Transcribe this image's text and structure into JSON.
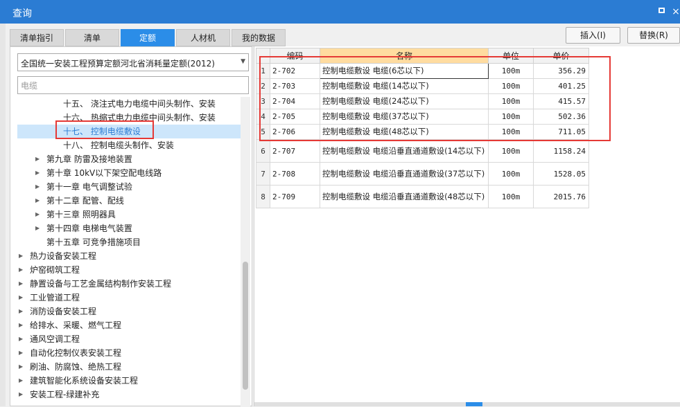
{
  "window": {
    "title": "查询",
    "maximize_icon": "maximize-icon",
    "close_icon": "close-icon",
    "close_glyph": "×"
  },
  "tabs": [
    {
      "label": "清单指引",
      "active": false
    },
    {
      "label": "清单",
      "active": false
    },
    {
      "label": "定额",
      "active": true
    },
    {
      "label": "人材机",
      "active": false
    },
    {
      "label": "我的数据",
      "active": false
    }
  ],
  "actions": {
    "insert_label": "插入(I)",
    "replace_label": "替换(R)"
  },
  "left": {
    "quota_selected": "全国统一安装工程预算定额河北省消耗量定额(2012)",
    "search_value": "电缆",
    "tree": [
      {
        "label": "十五、 浇注式电力电缆中间头制作、安装",
        "indent": 3,
        "expander": false,
        "selected": false
      },
      {
        "label": "十六、 热缩式电力电缆中间头制作、安装",
        "indent": 3,
        "expander": false,
        "selected": false
      },
      {
        "label": "十七、 控制电缆敷设",
        "indent": 3,
        "expander": false,
        "selected": true
      },
      {
        "label": "十八、 控制电缆头制作、安装",
        "indent": 3,
        "expander": false,
        "selected": false
      },
      {
        "label": "第九章 防雷及接地装置",
        "indent": 2,
        "expander": true,
        "selected": false
      },
      {
        "label": "第十章 10kV以下架空配电线路",
        "indent": 2,
        "expander": true,
        "selected": false
      },
      {
        "label": "第十一章 电气调整试验",
        "indent": 2,
        "expander": true,
        "selected": false
      },
      {
        "label": "第十二章 配管、配线",
        "indent": 2,
        "expander": true,
        "selected": false
      },
      {
        "label": "第十三章 照明器具",
        "indent": 2,
        "expander": true,
        "selected": false
      },
      {
        "label": "第十四章 电梯电气装置",
        "indent": 2,
        "expander": true,
        "selected": false
      },
      {
        "label": "第十五章 可竞争措施项目",
        "indent": 2,
        "expander": false,
        "selected": false
      },
      {
        "label": "热力设备安装工程",
        "indent": 1,
        "expander": true,
        "selected": false
      },
      {
        "label": "炉窑砌筑工程",
        "indent": 1,
        "expander": true,
        "selected": false
      },
      {
        "label": "静置设备与工艺金属结构制作安装工程",
        "indent": 1,
        "expander": true,
        "selected": false
      },
      {
        "label": "工业管道工程",
        "indent": 1,
        "expander": true,
        "selected": false
      },
      {
        "label": "消防设备安装工程",
        "indent": 1,
        "expander": true,
        "selected": false
      },
      {
        "label": "给排水、采暖、燃气工程",
        "indent": 1,
        "expander": true,
        "selected": false
      },
      {
        "label": "通风空调工程",
        "indent": 1,
        "expander": true,
        "selected": false
      },
      {
        "label": "自动化控制仪表安装工程",
        "indent": 1,
        "expander": true,
        "selected": false
      },
      {
        "label": "刷油、防腐蚀、绝热工程",
        "indent": 1,
        "expander": true,
        "selected": false
      },
      {
        "label": "建筑智能化系统设备安装工程",
        "indent": 1,
        "expander": true,
        "selected": false
      },
      {
        "label": "安装工程-绿建补充",
        "indent": 1,
        "expander": true,
        "selected": false
      }
    ]
  },
  "grid": {
    "headers": {
      "code": "编码",
      "name": "名称",
      "unit": "单位",
      "price": "单价"
    },
    "rows": [
      {
        "idx": "1",
        "code": "2-702",
        "name": "控制电缆敷设 电缆(6芯以下)",
        "unit": "100m",
        "price": "356.29",
        "tall": false
      },
      {
        "idx": "2",
        "code": "2-703",
        "name": "控制电缆敷设 电缆(14芯以下)",
        "unit": "100m",
        "price": "401.25",
        "tall": false
      },
      {
        "idx": "3",
        "code": "2-704",
        "name": "控制电缆敷设 电缆(24芯以下)",
        "unit": "100m",
        "price": "415.57",
        "tall": false
      },
      {
        "idx": "4",
        "code": "2-705",
        "name": "控制电缆敷设 电缆(37芯以下)",
        "unit": "100m",
        "price": "502.36",
        "tall": false
      },
      {
        "idx": "5",
        "code": "2-706",
        "name": "控制电缆敷设 电缆(48芯以下)",
        "unit": "100m",
        "price": "711.05",
        "tall": false
      },
      {
        "idx": "6",
        "code": "2-707",
        "name": "控制电缆敷设 电缆沿垂直通道敷设(14芯以下)",
        "unit": "100m",
        "price": "1158.24",
        "tall": true
      },
      {
        "idx": "7",
        "code": "2-708",
        "name": "控制电缆敷设 电缆沿垂直通道敷设(37芯以下)",
        "unit": "100m",
        "price": "1528.05",
        "tall": true
      },
      {
        "idx": "8",
        "code": "2-709",
        "name": "控制电缆敷设 电缆沿垂直通道敷设(48芯以下)",
        "unit": "100m",
        "price": "2015.76",
        "tall": true
      }
    ]
  },
  "colors": {
    "accent": "#2b8de8",
    "titlebar": "#2b7cd3",
    "highlight_box": "#e53935",
    "header_highlight": "#ffdca0"
  }
}
